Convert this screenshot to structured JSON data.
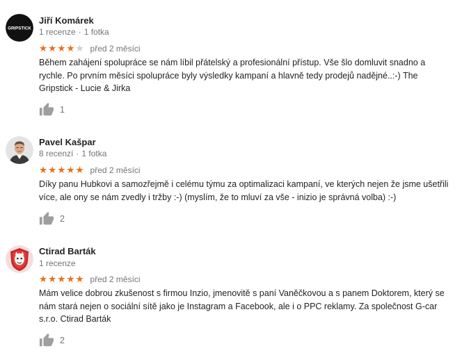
{
  "reviews": [
    {
      "author": "Jiří Komárek",
      "reviews_count": "1 recenze",
      "photos_count": "1 fotka",
      "stars_filled": 4,
      "stars_total": 5,
      "time": "před 2 měsíci",
      "text": "Během zahájení spolupráce se nám líbil přátelský a profesionální přístup. Vše šlo domluvit snadno a rychle. Po prvním měsíci spolupráce byly výsledky kampaní a hlavně tedy prodejů nadějné..:-) The Gripstick - Lucie & Jirka",
      "likes": "1",
      "avatar_logo_text": "GRIPSTICK"
    },
    {
      "author": "Pavel Kašpar",
      "reviews_count": "8 recenzí",
      "photos_count": "1 fotka",
      "stars_filled": 5,
      "stars_total": 5,
      "time": "před 2 měsíci",
      "text": "Díky panu Hubkovi a samozřejmě i celému týmu za optimalizaci kampaní, ve kterých nejen že jsme ušetřili více, ale ony se nám zvedly i tržby :-) (myslím, že to mluví za vše - inizio je správná volba) :-)",
      "likes": "2"
    },
    {
      "author": "Ctirad Barták",
      "reviews_count": "1 recenze",
      "stars_filled": 5,
      "stars_total": 5,
      "time": "před 2 měsíci",
      "text": "Mám velice dobrou zkušenost s firmou Inzio, jmenovitě s paní Vaněčkovou a s panem Doktorem, který se nám stará nejen o sociální sítě jako je Instagram a Facebook, ale i o PPC reklamy. Za společnost G-car s.r.o. Ctirad Barták",
      "likes": "2"
    }
  ],
  "colors": {
    "star": "#e7711b",
    "star_empty": "#cfcfcf",
    "meta_text": "#70757a",
    "like_icon": "#9e9e9e"
  },
  "icons": {
    "like": "thumb-up-icon",
    "star": "star-icon"
  }
}
